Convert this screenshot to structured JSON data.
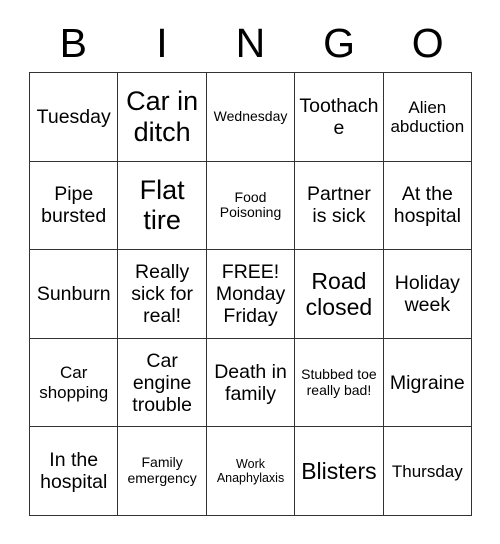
{
  "card": {
    "headers": [
      "B",
      "I",
      "N",
      "G",
      "O"
    ],
    "rows": [
      [
        {
          "text": "Tuesday",
          "size": "fs-md"
        },
        {
          "text": "Car in ditch",
          "size": "fs-xl"
        },
        {
          "text": "Wednesday",
          "size": "fs-xs"
        },
        {
          "text": "Toothache",
          "size": "fs-md"
        },
        {
          "text": "Alien abduction",
          "size": "fs-sm"
        }
      ],
      [
        {
          "text": "Pipe bursted",
          "size": "fs-md"
        },
        {
          "text": "Flat tire",
          "size": "fs-xl"
        },
        {
          "text": "Food Poisoning",
          "size": "fs-xs"
        },
        {
          "text": "Partner is sick",
          "size": "fs-md"
        },
        {
          "text": "At the hospital",
          "size": "fs-md"
        }
      ],
      [
        {
          "text": "Sunburn",
          "size": "fs-md"
        },
        {
          "text": "Really sick for real!",
          "size": "fs-md"
        },
        {
          "text": "FREE! Monday Friday",
          "size": "fs-md"
        },
        {
          "text": "Road closed",
          "size": "fs-lg"
        },
        {
          "text": "Holiday week",
          "size": "fs-md"
        }
      ],
      [
        {
          "text": "Car shopping",
          "size": "fs-sm"
        },
        {
          "text": "Car engine trouble",
          "size": "fs-md"
        },
        {
          "text": "Death in family",
          "size": "fs-md"
        },
        {
          "text": "Stubbed toe really bad!",
          "size": "fs-xs"
        },
        {
          "text": "Migraine",
          "size": "fs-md"
        }
      ],
      [
        {
          "text": "In the hospital",
          "size": "fs-md"
        },
        {
          "text": "Family emergency",
          "size": "fs-xs"
        },
        {
          "text": "Work Anaphylaxis",
          "size": "fs-xxs"
        },
        {
          "text": "Blisters",
          "size": "fs-lg"
        },
        {
          "text": "Thursday",
          "size": "fs-sm"
        }
      ]
    ]
  }
}
